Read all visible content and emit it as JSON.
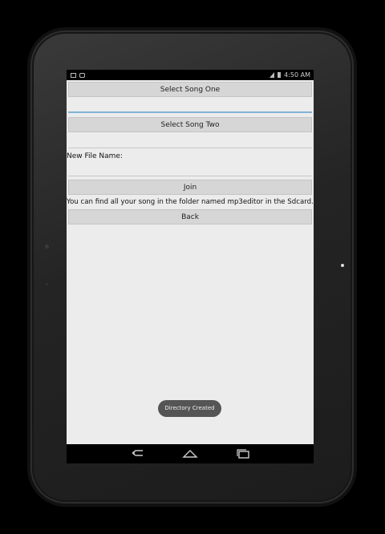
{
  "status_bar": {
    "time": "4:50 AM",
    "left_icons": [
      "image-icon",
      "app-notification-icon"
    ],
    "right_icons": [
      "signal-icon",
      "battery-icon"
    ]
  },
  "app": {
    "select_song_one_label": "Select Song One",
    "select_song_one_value": "",
    "select_song_two_label": "Select Song Two",
    "select_song_two_value": "",
    "new_file_name_label": "New File Name:",
    "new_file_name_value": "",
    "join_label": "Join",
    "info_text": "You can find all your song in the folder named mp3editor in the Sdcard.",
    "back_label": "Back"
  },
  "toast": {
    "message": "Directory Created"
  },
  "nav_bar": {
    "buttons": [
      "back-icon",
      "home-icon",
      "recent-apps-icon"
    ]
  },
  "colors": {
    "screen_background": "#ececec",
    "button_background": "#d6d6d6",
    "focus_underline": "#7fb3d5",
    "toast_background": "#555555"
  }
}
